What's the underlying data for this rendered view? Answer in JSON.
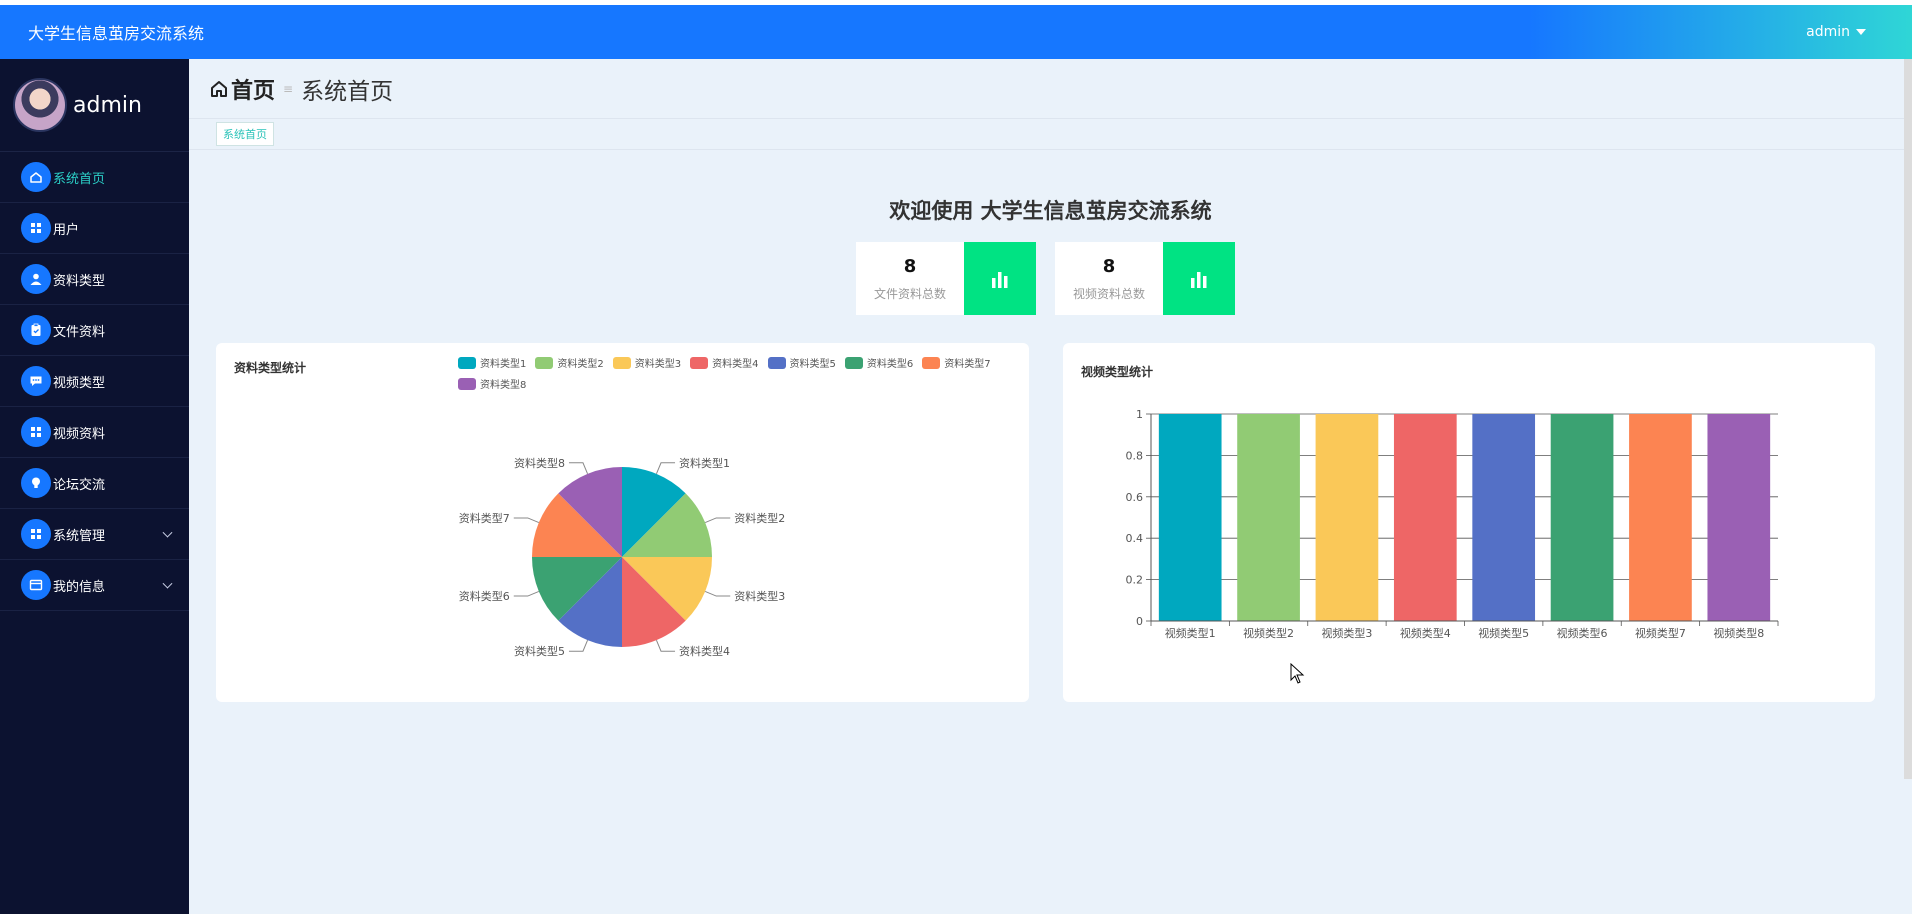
{
  "app": {
    "title": "大学生信息茧房交流系统",
    "user_menu": "admin"
  },
  "sidebar": {
    "username": "admin",
    "items": [
      {
        "label": "系统首页",
        "icon": "home-icon",
        "active": true
      },
      {
        "label": "用户",
        "icon": "grid-icon"
      },
      {
        "label": "资料类型",
        "icon": "person-icon"
      },
      {
        "label": "文件资料",
        "icon": "clipboard-icon"
      },
      {
        "label": "视频类型",
        "icon": "chat-icon"
      },
      {
        "label": "视频资料",
        "icon": "grid-icon"
      },
      {
        "label": "论坛交流",
        "icon": "bulb-icon"
      },
      {
        "label": "系统管理",
        "icon": "grid-icon",
        "expandable": true
      },
      {
        "label": "我的信息",
        "icon": "card-icon",
        "expandable": true
      }
    ]
  },
  "header": {
    "home_label": "首页",
    "crumb": "系统首页",
    "tag": "系统首页"
  },
  "welcome": "欢迎使用 大学生信息茧房交流系统",
  "stats": [
    {
      "value": "8",
      "label": "文件资料总数"
    },
    {
      "value": "8",
      "label": "视频资料总数"
    }
  ],
  "colors": [
    "#00a8bf",
    "#91cb74",
    "#fac858",
    "#ee6666",
    "#5470c6",
    "#3ba272",
    "#fc8452",
    "#9a60b4"
  ],
  "chart_data": [
    {
      "type": "pie",
      "title": "资料类型统计",
      "categories": [
        "资料类型1",
        "资料类型2",
        "资料类型3",
        "资料类型4",
        "资料类型5",
        "资料类型6",
        "资料类型7",
        "资料类型8"
      ],
      "values": [
        1,
        1,
        1,
        1,
        1,
        1,
        1,
        1
      ],
      "legend": "top"
    },
    {
      "type": "bar",
      "title": "视频类型统计",
      "categories": [
        "视频类型1",
        "视频类型2",
        "视频类型3",
        "视频类型4",
        "视频类型5",
        "视频类型6",
        "视频类型7",
        "视频类型8"
      ],
      "values": [
        1,
        1,
        1,
        1,
        1,
        1,
        1,
        1
      ],
      "ylim": [
        0,
        1
      ],
      "yticks": [
        "0",
        "0.2",
        "0.4",
        "0.6",
        "0.8",
        "1"
      ],
      "grid": true
    }
  ]
}
